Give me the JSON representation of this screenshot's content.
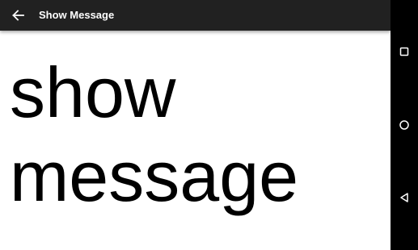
{
  "toolbar": {
    "title": "Show Message",
    "back_icon": "arrow-back-icon",
    "background": "#212121",
    "title_color": "#ffffff"
  },
  "content": {
    "message": "show message",
    "text_color": "#000000",
    "background": "#ffffff"
  },
  "navigation_bar": {
    "background": "#000000",
    "buttons": [
      {
        "name": "recents",
        "icon": "square-icon"
      },
      {
        "name": "home",
        "icon": "circle-icon"
      },
      {
        "name": "back",
        "icon": "triangle-back-icon"
      }
    ]
  }
}
